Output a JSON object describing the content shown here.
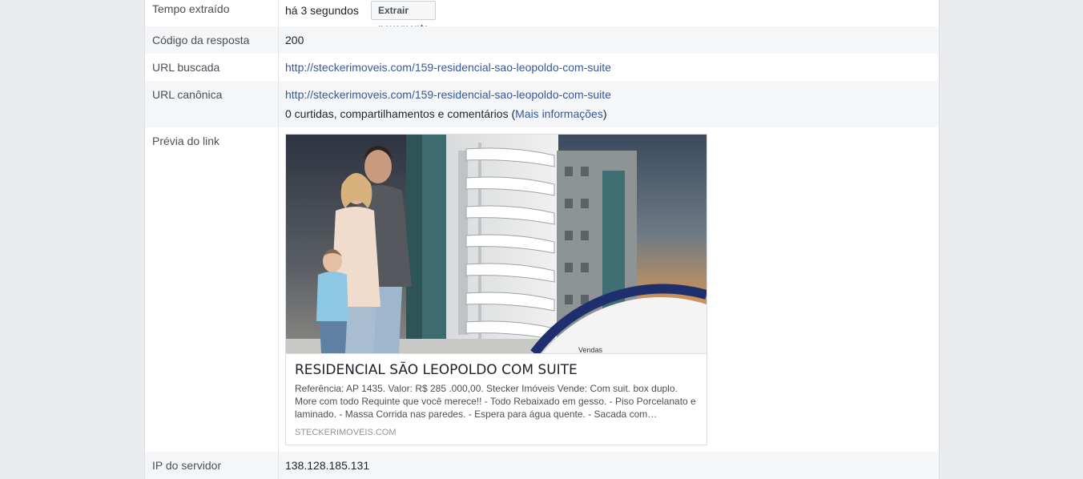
{
  "rows": {
    "time": {
      "label": "Tempo extraído",
      "value": "há 3 segundos",
      "button": "Extrair novamente"
    },
    "response": {
      "label": "Código da resposta",
      "value": "200"
    },
    "fetched": {
      "label": "URL buscada",
      "value": "http://steckerimoveis.com/159-residencial-sao-leopoldo-com-suite"
    },
    "canonical": {
      "label": "URL canônica",
      "value": "http://steckerimoveis.com/159-residencial-sao-leopoldo-com-suite",
      "stats_prefix": "0 curtidas, compartilhamentos e comentários (",
      "stats_link": "Mais informações",
      "stats_suffix": ")"
    },
    "preview": {
      "label": "Prévia do link",
      "image_caption": "Vendas",
      "title": "RESIDENCIAL SÃO LEOPOLDO COM SUITE",
      "description": "Referência: AP 1435. Valor: R$ 285 .000,00. Stecker Imóveis Vende: Com suit. box duplo. More com todo Requinte que você merece!! - Todo Rebaixado em gesso. - Piso Porcelanato e laminado. - Massa Corrida nas paredes. - Espera para água quente. - Sacada com…",
      "domain": "STECKERIMOVEIS.COM"
    },
    "ip": {
      "label": "IP do servidor",
      "value": "138.128.185.131"
    }
  }
}
